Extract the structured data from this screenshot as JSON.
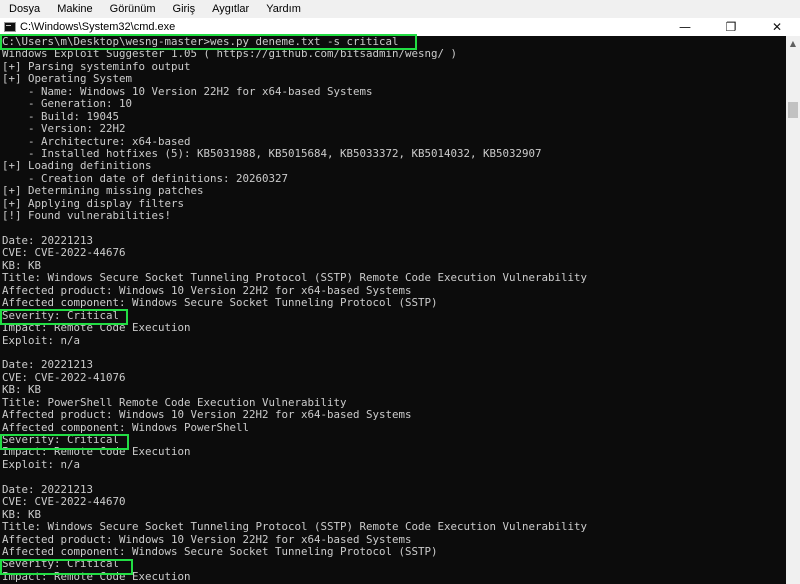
{
  "menubar": {
    "items": [
      "Dosya",
      "Makine",
      "Görünüm",
      "Giriş",
      "Aygıtlar",
      "Yardım"
    ]
  },
  "window": {
    "title": "C:\\Windows\\System32\\cmd.exe",
    "minimize": "—",
    "restore": "❐",
    "close": "✕"
  },
  "console": {
    "lines": [
      "C:\\Users\\m\\Desktop\\wesng-master>wes.py deneme.txt -s critical",
      "Windows Exploit Suggester 1.05 ( https://github.com/bitsadmin/wesng/ )",
      "[+] Parsing systeminfo output",
      "[+] Operating System",
      "    - Name: Windows 10 Version 22H2 for x64-based Systems",
      "    - Generation: 10",
      "    - Build: 19045",
      "    - Version: 22H2",
      "    - Architecture: x64-based",
      "    - Installed hotfixes (5): KB5031988, KB5015684, KB5033372, KB5014032, KB5032907",
      "[+] Loading definitions",
      "    - Creation date of definitions: 20260327",
      "[+] Determining missing patches",
      "[+] Applying display filters",
      "[!] Found vulnerabilities!",
      "",
      "Date: 20221213",
      "CVE: CVE-2022-44676",
      "KB: KB",
      "Title: Windows Secure Socket Tunneling Protocol (SSTP) Remote Code Execution Vulnerability",
      "Affected product: Windows 10 Version 22H2 for x64-based Systems",
      "Affected component: Windows Secure Socket Tunneling Protocol (SSTP)",
      "Severity: Critical",
      "Impact: Remote Code Execution",
      "Exploit: n/a",
      "",
      "Date: 20221213",
      "CVE: CVE-2022-41076",
      "KB: KB",
      "Title: PowerShell Remote Code Execution Vulnerability",
      "Affected product: Windows 10 Version 22H2 for x64-based Systems",
      "Affected component: Windows PowerShell",
      "Severity: Critical",
      "Impact: Remote Code Execution",
      "Exploit: n/a",
      "",
      "Date: 20221213",
      "CVE: CVE-2022-44670",
      "KB: KB",
      "Title: Windows Secure Socket Tunneling Protocol (SSTP) Remote Code Execution Vulnerability",
      "Affected product: Windows 10 Version 22H2 for x64-based Systems",
      "Affected component: Windows Secure Socket Tunneling Protocol (SSTP)",
      "Severity: Critical",
      "Impact: Remote Code Execution"
    ]
  },
  "colors": {
    "console_bg": "#0c0c0c",
    "console_text": "#cccccc",
    "highlight": "#22dd44"
  }
}
